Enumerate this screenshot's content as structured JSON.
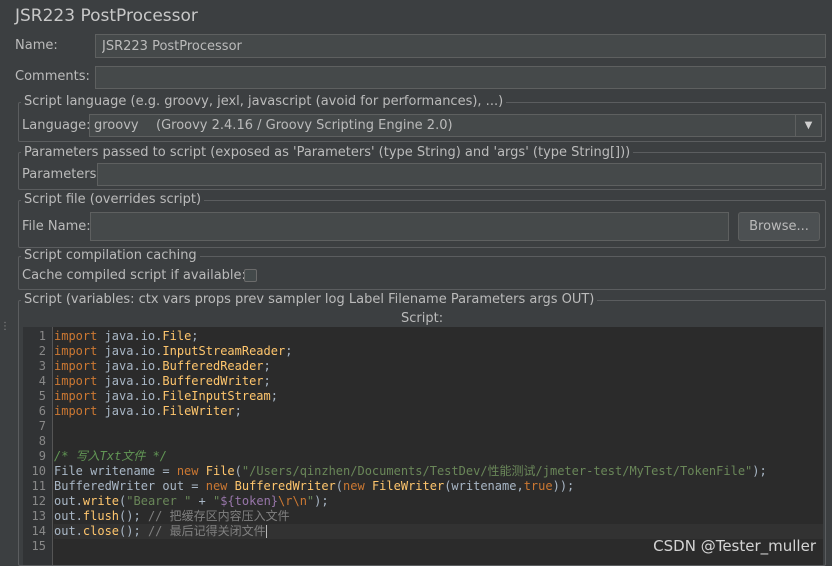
{
  "panel_title": "JSR223 PostProcessor",
  "name": {
    "label": "Name:",
    "value": "JSR223 PostProcessor"
  },
  "comments": {
    "label": "Comments:",
    "value": ""
  },
  "language_group": {
    "title": "Script language (e.g. groovy, jexl, javascript (avoid for performances), ...)",
    "label": "Language:",
    "selected_key": "groovy",
    "selected_desc": "(Groovy 2.4.16 / Groovy Scripting Engine 2.0)"
  },
  "params_group": {
    "title": "Parameters passed to script (exposed as 'Parameters' (type String) and 'args' (type String[]))",
    "label": "Parameters:",
    "value": ""
  },
  "file_group": {
    "title": "Script file (overrides script)",
    "label": "File Name:",
    "value": "",
    "browse_label": "Browse..."
  },
  "cache_group": {
    "title": "Script compilation caching",
    "label": "Cache compiled script if available:",
    "checked": false
  },
  "script_group": {
    "title": "Script (variables: ctx vars props prev sampler log Label Filename Parameters args OUT)",
    "subtitle": "Script:",
    "line_numbers": [
      "1",
      "2",
      "3",
      "4",
      "5",
      "6",
      "7",
      "8",
      "9",
      "10",
      "11",
      "12",
      "13",
      "14",
      "15"
    ],
    "lines": {
      "l1": {
        "kw": "import",
        "rest": " java.io.",
        "cls": "File",
        "end": ";"
      },
      "l2": {
        "kw": "import",
        "rest": " java.io.",
        "cls": "InputStreamReader",
        "end": ";"
      },
      "l3": {
        "kw": "import",
        "rest": " java.io.",
        "cls": "BufferedReader",
        "end": ";"
      },
      "l4": {
        "kw": "import",
        "rest": " java.io.",
        "cls": "BufferedWriter",
        "end": ";"
      },
      "l5": {
        "kw": "import",
        "rest": " java.io.",
        "cls": "FileInputStream",
        "end": ";"
      },
      "l6": {
        "kw": "import",
        "rest": " java.io.",
        "cls": "FileWriter",
        "end": ";"
      },
      "l9": "/* 写入Txt文件 */",
      "l10": {
        "a": "File writename = ",
        "kw": "new",
        "b": " ",
        "cls": "File",
        "c": "(",
        "str": "\"/Users/qinzhen/Documents/TestDev/性能测试/jmeter-test/MyTest/TokenFile\"",
        "d": ");"
      },
      "l11": {
        "a": "BufferedWriter out = ",
        "kw1": "new",
        "b": " ",
        "cls1": "BufferedWriter",
        "c": "(",
        "kw2": "new",
        "d": " ",
        "cls2": "FileWriter",
        "e": "(writename,",
        "kw3": "true",
        "f": "));"
      },
      "l12": {
        "a": "out.",
        "fn": "write",
        "b": "(",
        "s1": "\"Bearer \"",
        "c": " + ",
        "s2": "\"",
        "v": "${token}",
        "esc": "\\r\\n",
        "s3": "\"",
        "d": ");"
      },
      "l13": {
        "a": "out.",
        "fn": "flush",
        "b": "(); ",
        "cm": "// 把缓存区内容压入文件"
      },
      "l14": {
        "a": "out.",
        "fn": "close",
        "b": "(); ",
        "cm": "// 最后记得关闭文件"
      }
    }
  },
  "watermark": "CSDN @Tester_muller",
  "colors": {
    "background": "#3c3f41",
    "editor_bg": "#2b2b2b",
    "keyword": "#cc7832",
    "string": "#6a8759",
    "class_name": "#ffc66d",
    "comment": "#808080"
  }
}
